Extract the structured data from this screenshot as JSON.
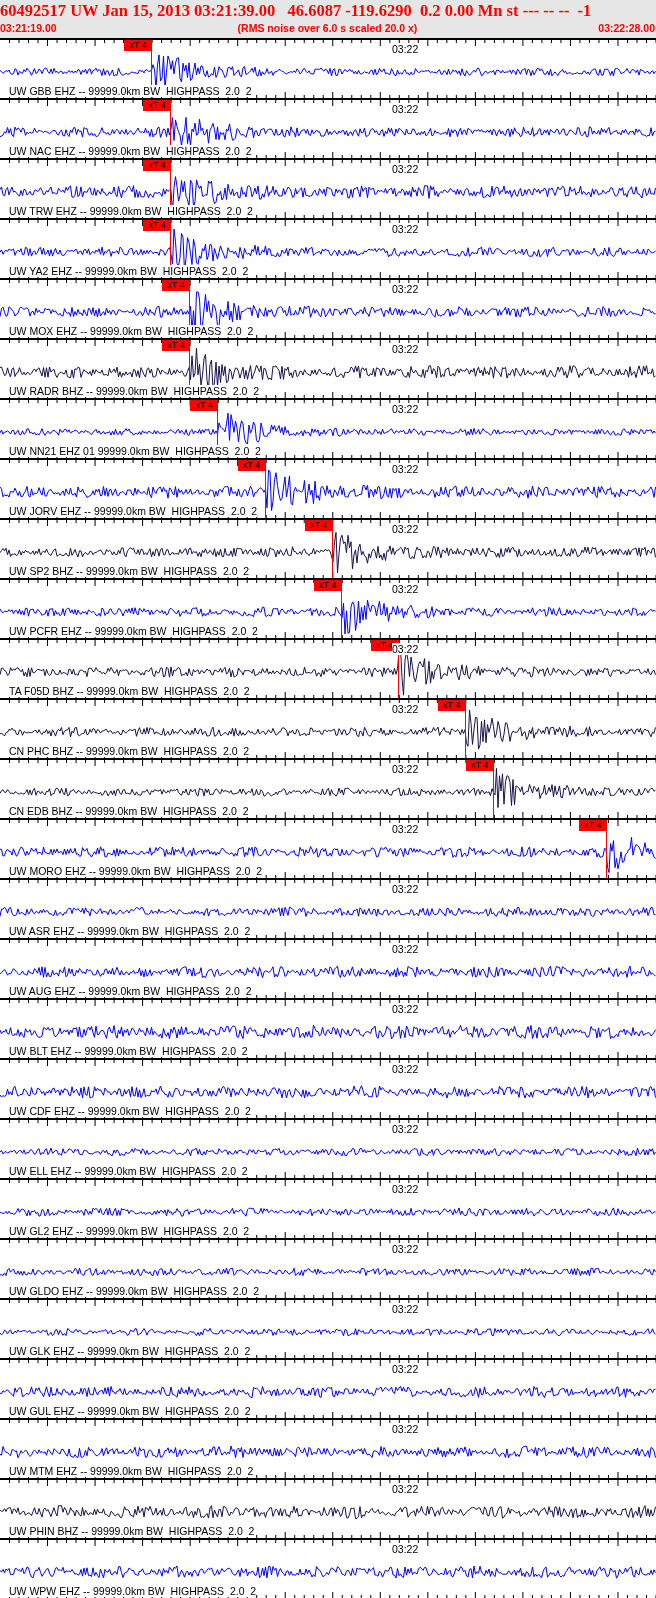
{
  "header": {
    "title": "60492517 UW Jan 15, 2013 03:21:39.00   46.6087 -119.6290  0.2 0.00 Mn st --- -- --  -1",
    "start_time": "03:21:19.00",
    "note": "(RMS noise over 6.0 s scaled 20.0 x)",
    "end_time": "03:22:28.00"
  },
  "traces": [
    {
      "label": "UW GBB EHZ -- 99999.0km BW  HIGHPASS  2.0  2",
      "time_label": "03:22",
      "color": "#0000ff",
      "pick": {
        "label": "xT 4",
        "level": 0.232
      }
    },
    {
      "label": "UW NAC EHZ -- 99999.0km BW  HIGHPASS  2.0  2",
      "time_label": "03:22",
      "color": "#0000ff",
      "pick": {
        "label": "xT 4",
        "level": 0.261
      }
    },
    {
      "label": "UW TRW EHZ -- 99999.0km BW  HIGHPASS  2.0  2",
      "time_label": "03:22",
      "color": "#0000ff",
      "pick": {
        "label": "xT 4",
        "level": 0.261
      }
    },
    {
      "label": "UW YA2 EHZ -- 99999.0km BW  HIGHPASS  2.0  2",
      "time_label": "03:22",
      "color": "#0000ff",
      "pick": {
        "label": "xT 4",
        "level": 0.261
      }
    },
    {
      "label": "UW MOX EHZ -- 99999.0km BW  HIGHPASS  2.0  2",
      "time_label": "03:22",
      "color": "#0000ff",
      "pick": {
        "label": "xT 4",
        "level": 0.29
      }
    },
    {
      "label": "UW RADR BHZ -- 99999.0km BW  HIGHPASS  2.0  2",
      "time_label": "03:22",
      "color": "#1a0f4d",
      "pick": {
        "label": "xT 4",
        "level": 0.29
      }
    },
    {
      "label": "UW NN21 EHZ 01 99999.0km BW  HIGHPASS  2.0  2",
      "time_label": "03:22",
      "color": "#0000ff",
      "pick": {
        "label": "xT 4",
        "level": 0.333
      }
    },
    {
      "label": "UW JORV EHZ -- 99999.0km BW  HIGHPASS  2.0  2",
      "time_label": "03:22",
      "color": "#0000ff",
      "pick": {
        "label": "xT 4",
        "level": 0.405
      }
    },
    {
      "label": "UW SP2 BHZ -- 99999.0km BW  HIGHPASS  2.0  2",
      "time_label": "03:22",
      "color": "#1a0f4d",
      "pick": {
        "label": "xT 4",
        "level": 0.507
      }
    },
    {
      "label": "UW PCFR EHZ -- 99999.0km BW  HIGHPASS  2.0  2",
      "time_label": "03:22",
      "color": "#0000ff",
      "pick": {
        "label": "xT 4",
        "level": 0.521
      }
    },
    {
      "label": "TA F05D BHZ -- 99999.0km BW  HIGHPASS  2.0  2",
      "time_label": "03:22",
      "color": "#1a0f4d",
      "pick": {
        "label": "xT 4",
        "level": 0.608
      }
    },
    {
      "label": "CN PHC BHZ -- 99999.0km BW  HIGHPASS  2.0  2",
      "time_label": "03:22",
      "color": "#1a0f4d",
      "pick": {
        "label": "xT 4",
        "level": 0.71
      }
    },
    {
      "label": "CN EDB BHZ -- 99999.0km BW  HIGHPASS  2.0  2",
      "time_label": "03:22",
      "color": "#1a0f4d",
      "pick": {
        "label": "xT 4",
        "level": 0.753
      }
    },
    {
      "label": "UW MORO EHZ -- 99999.0km BW  HIGHPASS  2.0  2",
      "time_label": "03:22",
      "color": "#0000ff",
      "pick": {
        "label": "xT 4",
        "level": 0.925
      }
    },
    {
      "label": "UW ASR EHZ -- 99999.0km BW  HIGHPASS  2.0  2",
      "time_label": "03:22",
      "color": "#0000ff"
    },
    {
      "label": "UW AUG EHZ -- 99999.0km BW  HIGHPASS  2.0  2",
      "time_label": "03:22",
      "color": "#0000ff"
    },
    {
      "label": "UW BLT EHZ -- 99999.0km BW  HIGHPASS  2.0  2",
      "time_label": "03:22",
      "color": "#0000ff"
    },
    {
      "label": "UW CDF EHZ -- 99999.0km BW  HIGHPASS  2.0  2",
      "time_label": "03:22",
      "color": "#0000ff"
    },
    {
      "label": "UW ELL EHZ -- 99999.0km BW  HIGHPASS  2.0  2",
      "time_label": "03:22",
      "color": "#0000ff"
    },
    {
      "label": "UW GL2 EHZ -- 99999.0km BW  HIGHPASS  2.0  2",
      "time_label": "03:22",
      "color": "#0000ff"
    },
    {
      "label": "UW GLDO EHZ -- 99999.0km BW  HIGHPASS  2.0  2",
      "time_label": "03:22",
      "color": "#0000ff"
    },
    {
      "label": "UW GLK EHZ -- 99999.0km BW  HIGHPASS  2.0  2",
      "time_label": "03:22",
      "color": "#0000ff"
    },
    {
      "label": "UW GUL EHZ -- 99999.0km BW  HIGHPASS  2.0  2",
      "time_label": "03:22",
      "color": "#0000ff"
    },
    {
      "label": "UW MTM EHZ -- 99999.0km BW  HIGHPASS  2.0  2",
      "time_label": "03:22",
      "color": "#0000ff"
    },
    {
      "label": "UW PHIN BHZ -- 99999.0km BW  HIGHPASS  2.0  2",
      "time_label": "03:22",
      "color": "#1a0f4d"
    },
    {
      "label": "UW WPW EHZ -- 99999.0km BW  HIGHPASS  2.0  2",
      "time_label": "03:22",
      "color": "#0000ff"
    }
  ]
}
